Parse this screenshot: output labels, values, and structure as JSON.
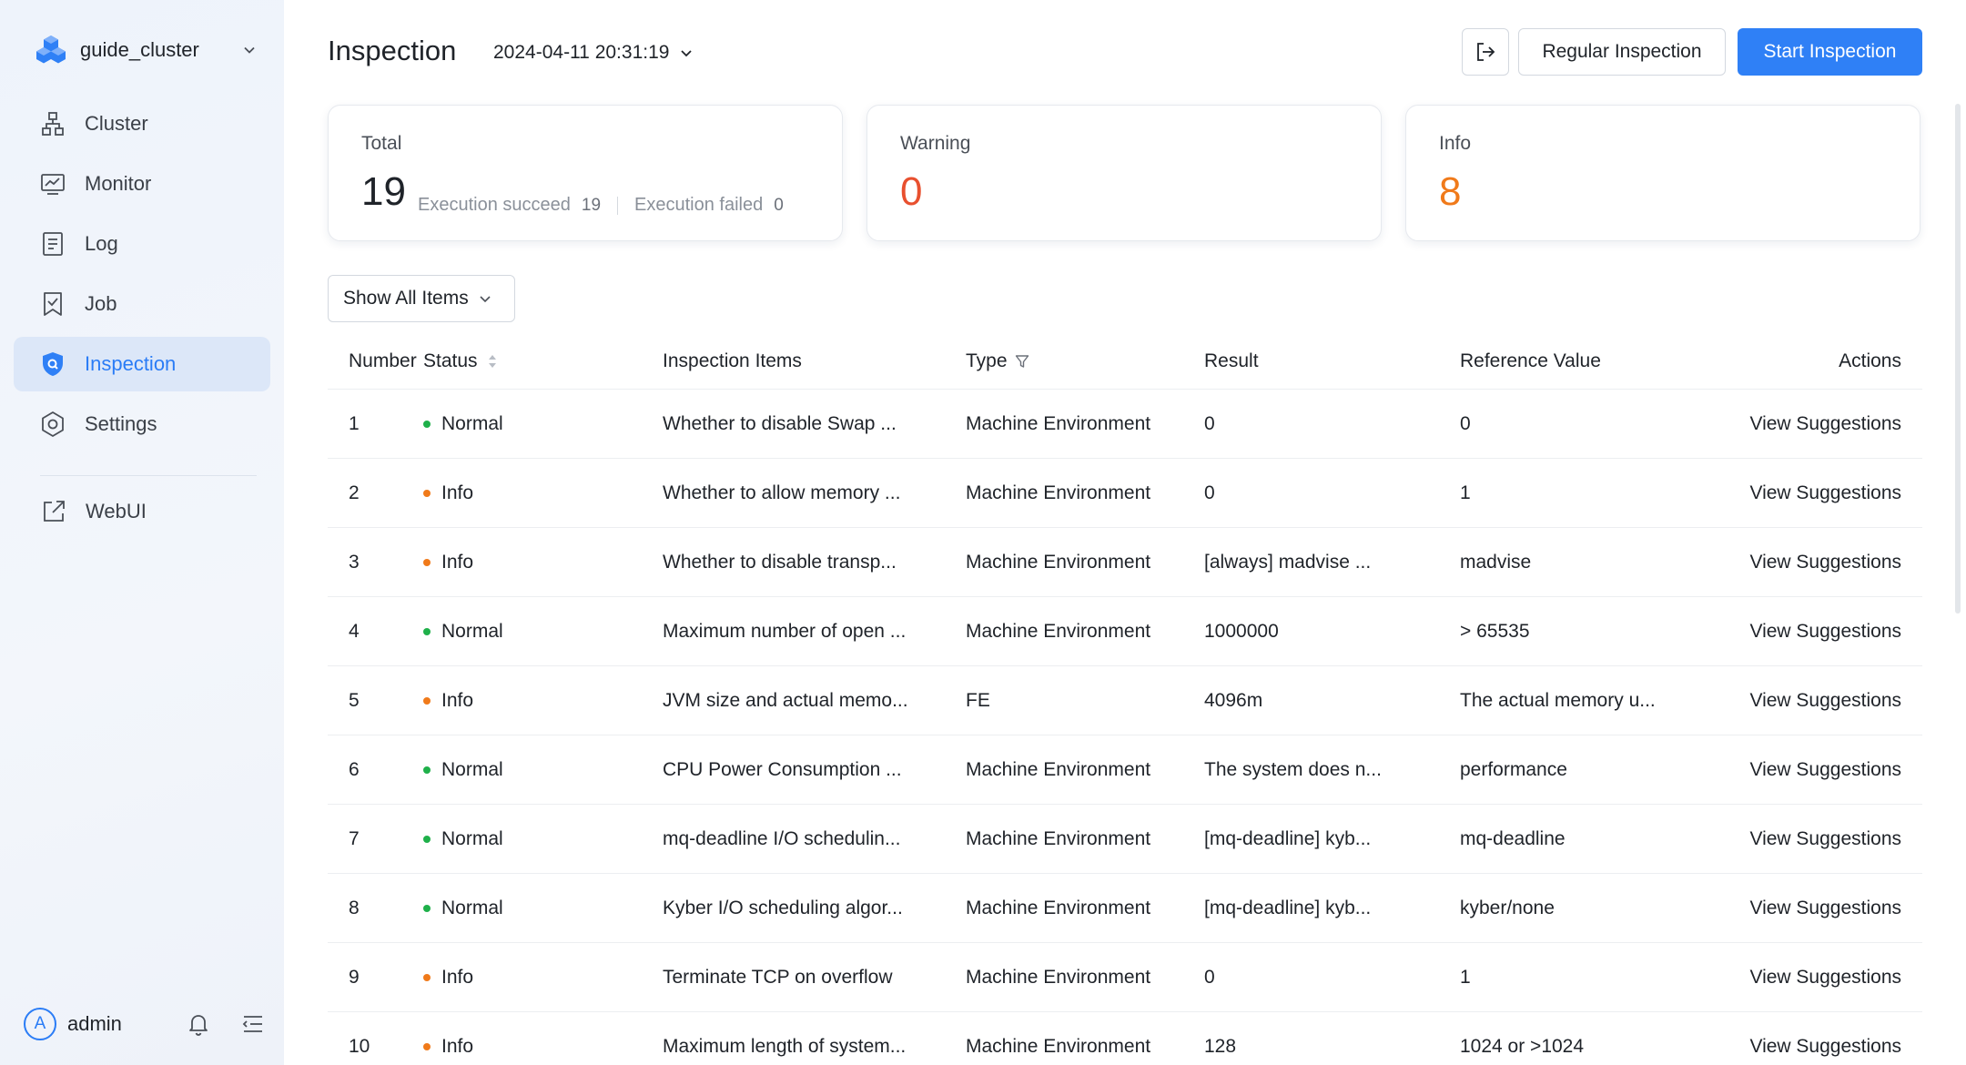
{
  "sidebar": {
    "cluster_name": "guide_cluster",
    "items": [
      {
        "key": "cluster",
        "label": "Cluster",
        "icon": "cluster-icon"
      },
      {
        "key": "monitor",
        "label": "Monitor",
        "icon": "monitor-icon"
      },
      {
        "key": "log",
        "label": "Log",
        "icon": "log-icon"
      },
      {
        "key": "job",
        "label": "Job",
        "icon": "job-icon"
      },
      {
        "key": "inspection",
        "label": "Inspection",
        "icon": "shield-icon",
        "active": true
      },
      {
        "key": "settings",
        "label": "Settings",
        "icon": "gear-icon"
      }
    ],
    "webui_label": "WebUI",
    "user": {
      "avatar_letter": "A",
      "name": "admin"
    }
  },
  "header": {
    "title": "Inspection",
    "datetime": "2024-04-11 20:31:19",
    "regular_label": "Regular Inspection",
    "start_label": "Start Inspection"
  },
  "summary": {
    "total": {
      "label": "Total",
      "value": "19",
      "succeed_label": "Execution succeed",
      "succeed_value": "19",
      "failed_label": "Execution failed",
      "failed_value": "0"
    },
    "warning": {
      "label": "Warning",
      "value": "0"
    },
    "info": {
      "label": "Info",
      "value": "8"
    }
  },
  "filter": {
    "label": "Show All Items"
  },
  "table": {
    "columns": {
      "number": "Number",
      "status": "Status",
      "items": "Inspection Items",
      "type": "Type",
      "result": "Result",
      "reference": "Reference Value",
      "actions": "Actions"
    },
    "rows": [
      {
        "number": "1",
        "status": "Normal",
        "item": "Whether to disable Swap ...",
        "type": "Machine Environment",
        "result": "0",
        "reference": "0",
        "action": "View Suggestions"
      },
      {
        "number": "2",
        "status": "Info",
        "item": "Whether to allow memory ...",
        "type": "Machine Environment",
        "result": "0",
        "reference": "1",
        "action": "View Suggestions"
      },
      {
        "number": "3",
        "status": "Info",
        "item": "Whether to disable transp...",
        "type": "Machine Environment",
        "result": "[always] madvise ...",
        "reference": "madvise",
        "action": "View Suggestions"
      },
      {
        "number": "4",
        "status": "Normal",
        "item": "Maximum number of open ...",
        "type": "Machine Environment",
        "result": "1000000",
        "reference": "> 65535",
        "action": "View Suggestions"
      },
      {
        "number": "5",
        "status": "Info",
        "item": "JVM size and actual memo...",
        "type": "FE",
        "result": "4096m",
        "reference": "The actual memory u...",
        "action": "View Suggestions"
      },
      {
        "number": "6",
        "status": "Normal",
        "item": "CPU Power Consumption ...",
        "type": "Machine Environment",
        "result": "The system does n...",
        "reference": "performance",
        "action": "View Suggestions"
      },
      {
        "number": "7",
        "status": "Normal",
        "item": "mq-deadline I/O schedulin...",
        "type": "Machine Environment",
        "result": "[mq-deadline] kyb...",
        "reference": "mq-deadline",
        "action": "View Suggestions"
      },
      {
        "number": "8",
        "status": "Normal",
        "item": "Kyber I/O scheduling algor...",
        "type": "Machine Environment",
        "result": "[mq-deadline] kyb...",
        "reference": "kyber/none",
        "action": "View Suggestions"
      },
      {
        "number": "9",
        "status": "Info",
        "item": "Terminate TCP on overflow",
        "type": "Machine Environment",
        "result": "0",
        "reference": "1",
        "action": "View Suggestions"
      },
      {
        "number": "10",
        "status": "Info",
        "item": "Maximum length of system...",
        "type": "Machine Environment",
        "result": "128",
        "reference": "1024 or >1024",
        "action": "View Suggestions"
      }
    ]
  },
  "colors": {
    "accent": "#2f80f6",
    "warning": "#e8502f",
    "info": "#f07a1a",
    "normal": "#1fb04a"
  }
}
